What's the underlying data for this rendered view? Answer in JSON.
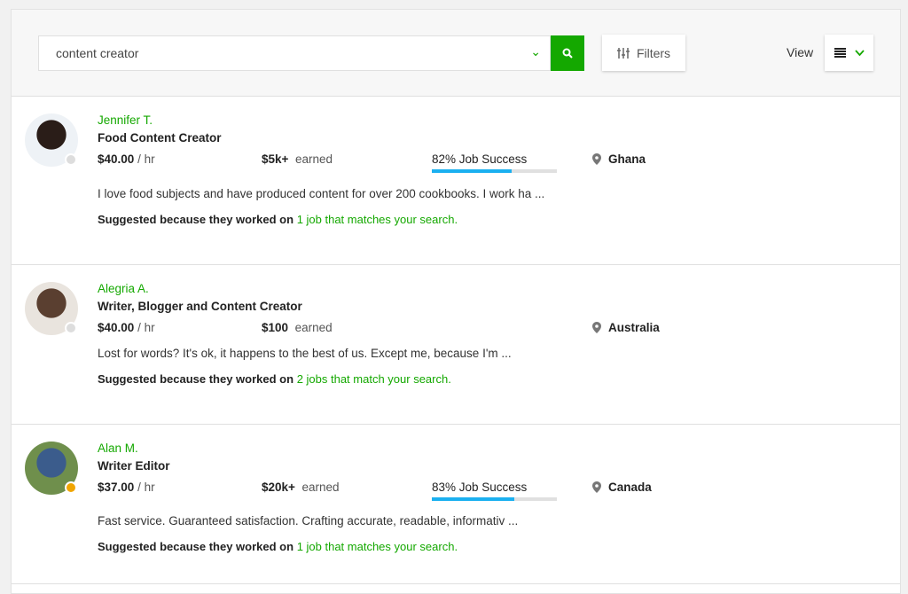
{
  "search": {
    "value": "content creator"
  },
  "toolbar": {
    "filters_label": "Filters",
    "view_label": "View"
  },
  "colors": {
    "accent": "#14a800",
    "bar": "#1bb0f0"
  },
  "freelancers": [
    {
      "name": "Jennifer T.",
      "title": "Food Content Creator",
      "rate": "$40.00",
      "rate_unit": "/ hr",
      "earned": "$5k+",
      "earned_label": "earned",
      "job_success": "82% Job Success",
      "bar_fill": 0.64,
      "location": "Ghana",
      "description": "I love food subjects and have produced content for over 200 cookbooks. I work ha ...",
      "suggested_prefix": "Suggested because they worked on",
      "suggested_link": "1 job that matches your search.",
      "status_color": "#ddd",
      "avatar_bg": "#2a1d18",
      "avatar_bg2": "#eef2f6"
    },
    {
      "name": "Alegria A.",
      "title": "Writer, Blogger and Content Creator",
      "rate": "$40.00",
      "rate_unit": "/ hr",
      "earned": "$100",
      "earned_label": "earned",
      "job_success": null,
      "bar_fill": null,
      "location": "Australia",
      "description": "Lost for words? It's ok, it happens to the best of us. Except me, because I'm ...",
      "suggested_prefix": "Suggested because they worked on",
      "suggested_link": "2 jobs that match your search.",
      "status_color": "#ddd",
      "avatar_bg": "#5a3f30",
      "avatar_bg2": "#e9e4de"
    },
    {
      "name": "Alan M.",
      "title": "Writer Editor",
      "rate": "$37.00",
      "rate_unit": "/ hr",
      "earned": "$20k+",
      "earned_label": "earned",
      "job_success": "83% Job Success",
      "bar_fill": 0.66,
      "location": "Canada",
      "description": "Fast service. Guaranteed satisfaction. Crafting accurate, readable, informativ ...",
      "suggested_prefix": "Suggested because they worked on",
      "suggested_link": "1 job that matches your search.",
      "status_color": "#f0a500",
      "avatar_bg": "#3b5c8c",
      "avatar_bg2": "#6f8f4c"
    }
  ]
}
